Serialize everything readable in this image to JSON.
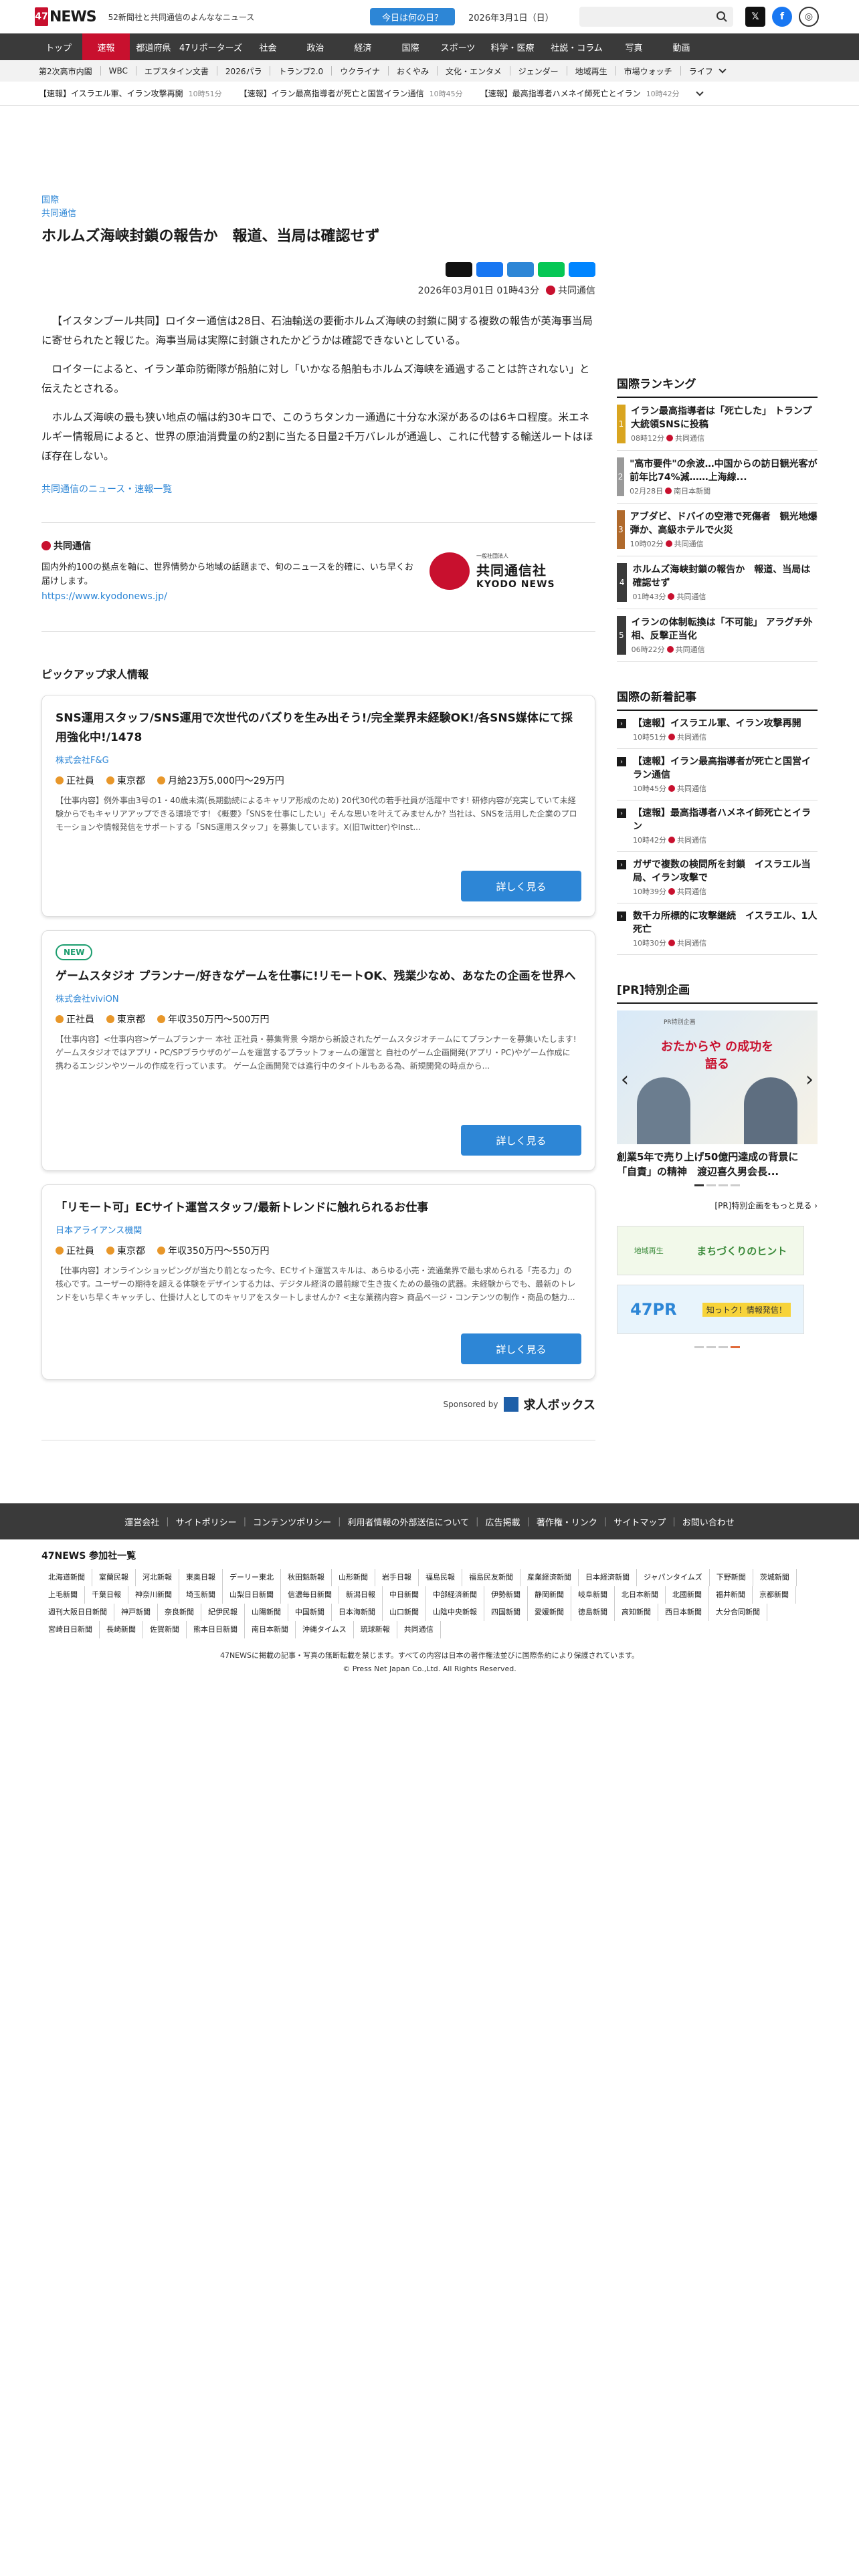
{
  "header": {
    "logo_box": "47",
    "logo_word": "NEWS",
    "tagline": "52新聞社と共同通信のよんななニュース",
    "today_button": "今日は何の日？",
    "date": "2026年3月1日（日）",
    "search_placeholder": ""
  },
  "nav": [
    "トップ",
    "速報",
    "都道府県",
    "47リポーターズ",
    "社会",
    "政治",
    "経済",
    "国際",
    "スポーツ",
    "科学・医療",
    "社説・コラム",
    "写真",
    "動画"
  ],
  "subnav": [
    "第2次高市内閣",
    "WBC",
    "エプスタイン文書",
    "2026パラ",
    "トランプ2.0",
    "ウクライナ",
    "おくやみ",
    "文化・エンタメ",
    "ジェンダー",
    "地域再生",
    "市場ウォッチ",
    "ライフ"
  ],
  "ticker": [
    {
      "text": "【速報】イスラエル軍、イラン攻撃再開",
      "time": "10時51分"
    },
    {
      "text": "【速報】イラン最高指導者が死亡と国営イラン通信",
      "time": "10時45分"
    },
    {
      "text": "【速報】最高指導者ハメネイ師死亡とイラン",
      "time": "10時42分"
    }
  ],
  "article": {
    "category": "国際",
    "source": "共同通信",
    "title": "ホルムズ海峡封鎖の報告か　報道、当局は確認せず",
    "datetime": "2026年03月01日 01時43分",
    "agency": "共同通信",
    "paragraphs": [
      "【イスタンブール共同】ロイター通信は28日、石油輸送の要衝ホルムズ海峡の封鎖に関する複数の報告が英海事当局に寄せられたと報じた。海事当局は実際に封鎖されたかどうかは確認できないとしている。",
      "ロイターによると、イラン革命防衛隊が船舶に対し「いかなる船舶もホルムズ海峡を通過することは許されない」と伝えたとされる。",
      "ホルムズ海峡の最も狭い地点の幅は約30キロで、このうちタンカー通過に十分な水深があるのは6キロ程度。米エネルギー情報局によると、世界の原油消費量の約2割に当たる日量2千万バレルが通過し、これに代替する輸送ルートはほぼ存在しない。"
    ],
    "more_link": "共同通信のニュース・速報一覧"
  },
  "agency": {
    "name": "共同通信",
    "desc": "国内外約100の拠点を軸に、世界情勢から地域の話題まで、旬のニュースを的確に、いち早くお届けします。",
    "url": "https://www.kyodonews.jp/",
    "logo_text": "共同通信社",
    "logo_sub": "KYODO NEWS",
    "logo_small": "一般社団法人"
  },
  "jobs": {
    "heading": "ピックアップ求人情報",
    "detail_label": "詳しく見る",
    "sponsored": "Sponsored by",
    "sponsor_name": "求人ボックス",
    "items": [
      {
        "badge": "",
        "title": "SNS運用スタッフ/SNS運用で次世代のバズりを生み出そう!/完全業界未経験OK!/各SNS媒体にて採用強化中!/1478",
        "company": "株式会社F&G",
        "type": "正社員",
        "place": "東京都",
        "salary": "月給23万5,000円〜29万円",
        "desc": "【仕事内容】例外事由3号の1・40歳未満(長期勤続によるキャリア形成のため) 20代30代の若手社員が活躍中です! 研修内容が充実していて未経験からでもキャリアアップできる環境です! 《概要》「SNSを仕事にしたい」そんな思いを叶えてみませんか? 当社は、SNSを活用した企業のプロモーションや情報発信をサポートする「SNS運用スタッフ」を募集しています。X(旧Twitter)やInst..."
      },
      {
        "badge": "NEW",
        "title": "ゲームスタジオ プランナー/好きなゲームを仕事に!リモートOK、残業少なめ、あなたの企画を世界へ",
        "company": "株式会社viviON",
        "type": "正社員",
        "place": "東京都",
        "salary": "年収350万円〜500万円",
        "desc": "【仕事内容】<仕事内容>ゲームプランナー 本社 正社員・募集背景 今期から新設されたゲームスタジオチームにてプランナーを募集いたします! ゲームスタジオではアプリ・PC/SPブラウザのゲームを運営するプラットフォームの運営と 自社のゲーム企画開発(アプリ・PC)やゲーム作成に携わるエンジンやツールの作成を行っています。 ゲーム企画開発では進行中のタイトルもある為、新規開発の時点から..."
      },
      {
        "badge": "",
        "title": "「リモート可」ECサイト運営スタッフ/最新トレンドに触れられるお仕事",
        "company": "日本アライアンス機関",
        "type": "正社員",
        "place": "東京都",
        "salary": "年収350万円〜550万円",
        "desc": "【仕事内容】オンラインショッピングが当たり前となった今、ECサイト運営スキルは、あらゆる小売・流通業界で最も求められる「売る力」の核心です。ユーザーの期待を超える体験をデザインする力は、デジタル経済の最前線で生き抜くための最強の武器。未経験からでも、最新のトレンドをいち早くキャッチし、仕掛け人としてのキャリアをスタートしませんか? <主な業務内容> 商品ページ・コンテンツの制作・商品の魅力..."
      }
    ]
  },
  "sidebar": {
    "ranking_heading": "国際ランキング",
    "ranking": [
      {
        "n": "1",
        "title": "イラン最高指導者は「死亡した」 トランプ大統領SNSに投稿",
        "time": "08時12分",
        "src": "共同通信",
        "color": "#d9a520"
      },
      {
        "n": "2",
        "title": "\"高市要件\"の余波…中国からの訪日観光客が前年比74%減……上海線...",
        "time": "02月28日",
        "src": "南日本新聞",
        "color": "#9a9a9a"
      },
      {
        "n": "3",
        "title": "アブダビ、ドバイの空港で死傷者　観光地爆弾か、高級ホテルで火災",
        "time": "10時02分",
        "src": "共同通信",
        "color": "#b06a2c"
      },
      {
        "n": "4",
        "title": "ホルムズ海峡封鎖の報告か　報道、当局は確認せず",
        "time": "01時43分",
        "src": "共同通信",
        "color": "#3a3a3a"
      },
      {
        "n": "5",
        "title": "イランの体制転換は「不可能」 アラグチ外相、反撃正当化",
        "time": "06時22分",
        "src": "共同通信",
        "color": "#3a3a3a"
      }
    ],
    "news_heading": "国際の新着記事",
    "news": [
      {
        "title": "【速報】イスラエル軍、イラン攻撃再開",
        "time": "10時51分",
        "src": "共同通信"
      },
      {
        "title": "【速報】イラン最高指導者が死亡と国営イラン通信",
        "time": "10時45分",
        "src": "共同通信"
      },
      {
        "title": "【速報】最高指導者ハメネイ師死亡とイラン",
        "time": "10時42分",
        "src": "共同通信"
      },
      {
        "title": "ガザで複数の検問所を封鎖　イスラエル当局、イラン攻撃で",
        "time": "10時39分",
        "src": "共同通信"
      },
      {
        "title": "数千カ所標的に攻撃継続　イスラエル、1人死亡",
        "time": "10時30分",
        "src": "共同通信"
      }
    ],
    "pr_heading": "[PR]特別企画",
    "pr_banner_small": "PR特別企画",
    "pr_banner_text": "おたからや の成功を語る",
    "pr_title": "創業5年で売り上げ50億円達成の背景に「自責」の精神　渡辺喜久男会長...",
    "pr_more": "[PR]特別企画をもっと見る",
    "banner1": "まちづくりのヒント",
    "banner1_sub": "地域再生",
    "banner2": "47PR",
    "banner2_sub": "知っトク！情報発信！"
  },
  "footer": {
    "links": [
      "運営会社",
      "サイトポリシー",
      "コンテンツポリシー",
      "利用者情報の外部送信について",
      "広告掲載",
      "著作権・リンク",
      "サイトマップ",
      "お問い合わせ"
    ]
  },
  "members": {
    "heading": "47NEWS 参加社一覧",
    "list": [
      "北海道新聞",
      "室蘭民報",
      "河北新報",
      "東奥日報",
      "デーリー東北",
      "秋田魁新報",
      "山形新聞",
      "岩手日報",
      "福島民報",
      "福島民友新聞",
      "産業経済新聞",
      "日本経済新聞",
      "ジャパンタイムズ",
      "下野新聞",
      "茨城新聞",
      "上毛新聞",
      "千葉日報",
      "神奈川新聞",
      "埼玉新聞",
      "山梨日日新聞",
      "信濃毎日新聞",
      "新潟日報",
      "中日新聞",
      "中部経済新聞",
      "伊勢新聞",
      "静岡新聞",
      "岐阜新聞",
      "北日本新聞",
      "北國新聞",
      "福井新聞",
      "京都新聞",
      "週刊大阪日日新聞",
      "神戸新聞",
      "奈良新聞",
      "紀伊民報",
      "山陽新聞",
      "中国新聞",
      "日本海新聞",
      "山口新聞",
      "山陰中央新報",
      "四国新聞",
      "愛媛新聞",
      "徳島新聞",
      "高知新聞",
      "西日本新聞",
      "大分合同新聞",
      "宮崎日日新聞",
      "長崎新聞",
      "佐賀新聞",
      "熊本日日新聞",
      "南日本新聞",
      "沖縄タイムス",
      "琉球新報",
      "共同通信"
    ],
    "notice": "47NEWSに掲載の記事・写真の無断転載を禁じます。すべての内容は日本の著作権法並びに国際条約により保護されています。",
    "copyright": "© Press Net Japan Co.,Ltd. All Rights Reserved."
  },
  "colors": {
    "brand": "#c8102e",
    "link": "#2d86d6",
    "nav_bg": "#3a3a3a",
    "new_badge": "#1b9d6e"
  }
}
